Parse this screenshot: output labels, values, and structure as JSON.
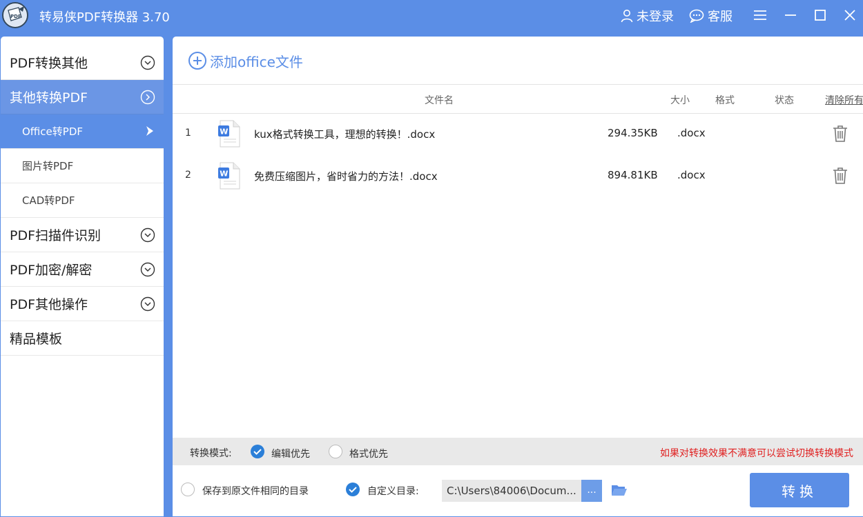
{
  "window": {
    "title": "转易侠PDF转换器 3.70",
    "login_label": "未登录",
    "service_label": "客服",
    "logo_text": "PDF"
  },
  "sidebar": {
    "items": [
      {
        "label": "PDF转换其他"
      },
      {
        "label": "其他转换PDF"
      },
      {
        "label": "Office转PDF"
      },
      {
        "label": "图片转PDF"
      },
      {
        "label": "CAD转PDF"
      },
      {
        "label": "PDF扫描件识别"
      },
      {
        "label": "PDF加密/解密"
      },
      {
        "label": "PDF其他操作"
      },
      {
        "label": "精品模板"
      }
    ]
  },
  "main": {
    "add_label": "添加office文件",
    "columns": {
      "name": "文件名",
      "size": "大小",
      "format": "格式",
      "status": "状态",
      "clear": "清除所有"
    },
    "files": [
      {
        "index": "1",
        "name": "kux格式转换工具，理想的转换！.docx",
        "size": "294.35KB",
        "format": ".docx"
      },
      {
        "index": "2",
        "name": "免费压缩图片，省时省力的方法！.docx",
        "size": "894.81KB",
        "format": ".docx"
      }
    ]
  },
  "mode": {
    "label": "转换模式:",
    "option_edit": "编辑优先",
    "option_format": "格式优先",
    "selected": "编辑优先",
    "hint": "如果对转换效果不满意可以尝试切换转换模式"
  },
  "output": {
    "same_dir_label": "保存到原文件相同的目录",
    "custom_dir_label": "自定义目录:",
    "selected": "自定义目录",
    "path_value": "C:\\Users\\84006\\Docum...",
    "browse_label": "...",
    "convert_label": "转换"
  },
  "colors": {
    "accent": "#5b8ee6",
    "hint_red": "#e02020",
    "radio_on": "#2b7fd8"
  }
}
